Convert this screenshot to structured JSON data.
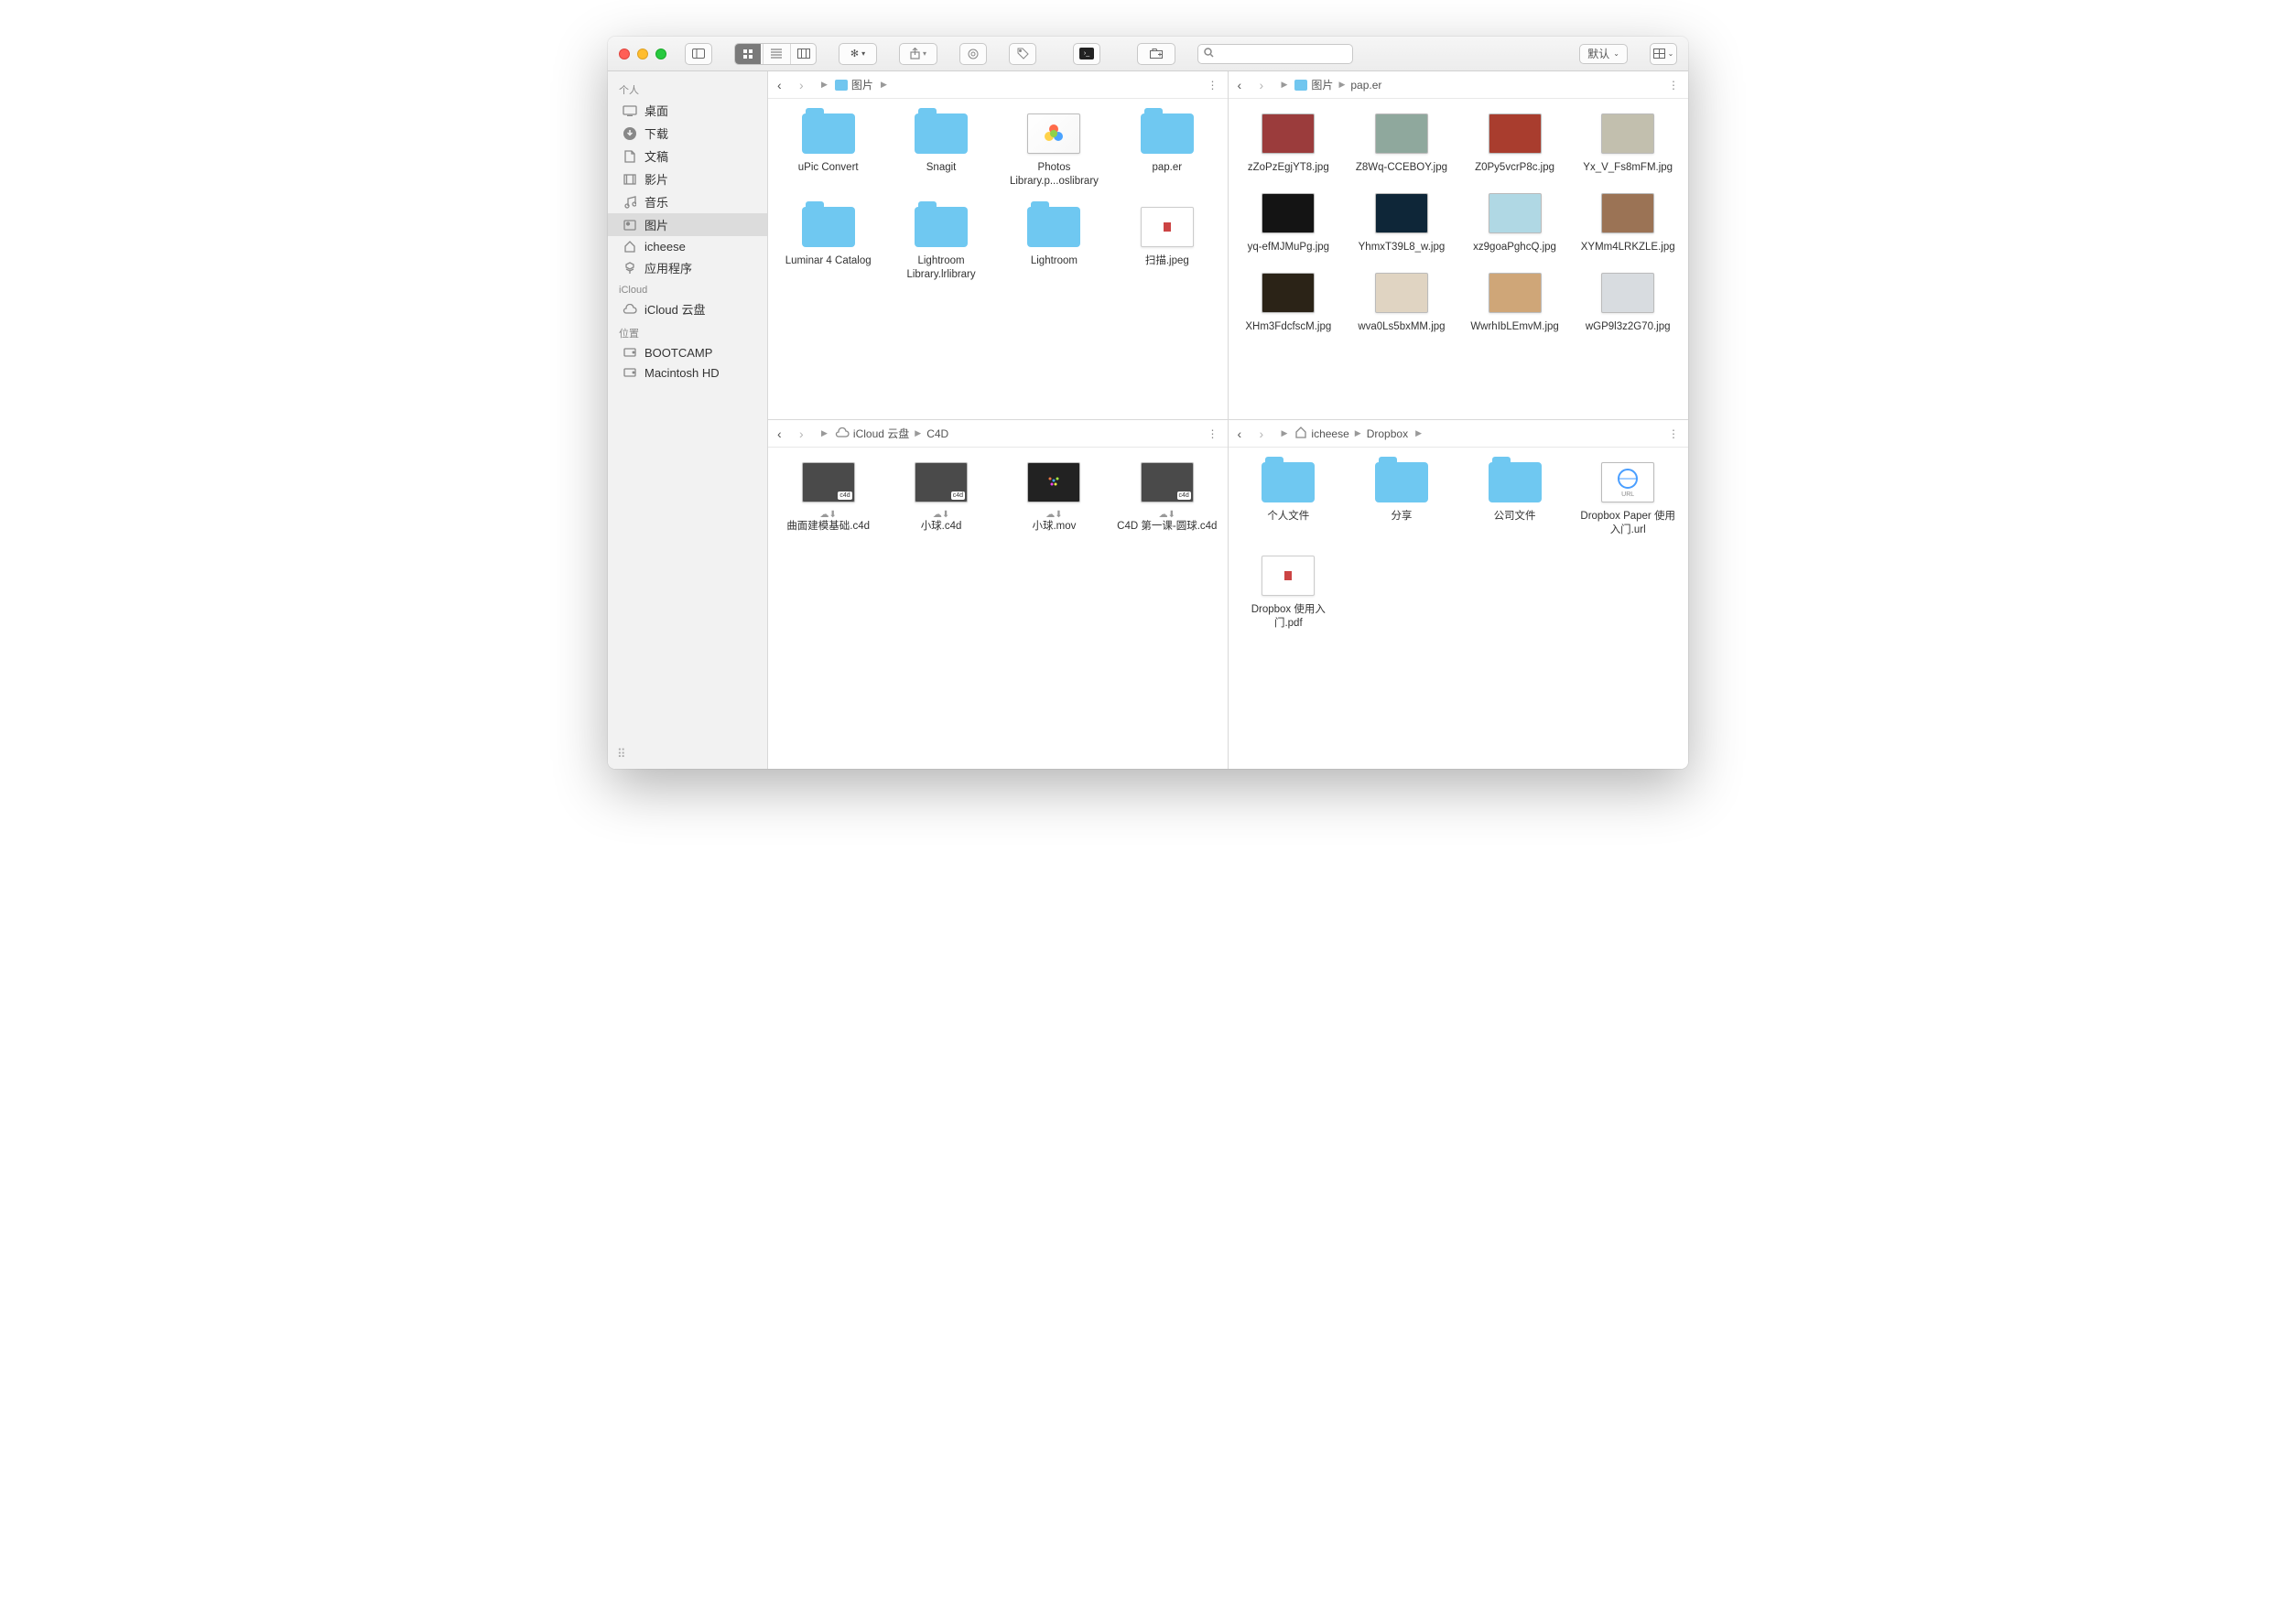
{
  "toolbar": {
    "default_label": "默认",
    "search_placeholder": ""
  },
  "sidebar": {
    "personal_header": "个人",
    "items_personal": [
      {
        "icon": "desktop",
        "label": "桌面"
      },
      {
        "icon": "download",
        "label": "下载"
      },
      {
        "icon": "documents",
        "label": "文稿"
      },
      {
        "icon": "movies",
        "label": "影片"
      },
      {
        "icon": "music",
        "label": "音乐"
      },
      {
        "icon": "pictures",
        "label": "图片"
      },
      {
        "icon": "home",
        "label": "icheese"
      },
      {
        "icon": "apps",
        "label": "应用程序"
      }
    ],
    "icloud_header": "iCloud",
    "items_icloud": [
      {
        "icon": "cloud",
        "label": "iCloud 云盘"
      }
    ],
    "locations_header": "位置",
    "items_locations": [
      {
        "icon": "disk",
        "label": "BOOTCAMP"
      },
      {
        "icon": "disk",
        "label": "Macintosh HD"
      }
    ]
  },
  "panes": [
    {
      "breadcrumb": [
        {
          "icon": "folder",
          "label": "图片"
        }
      ],
      "items": [
        {
          "type": "folder",
          "label": "uPic Convert"
        },
        {
          "type": "folder",
          "label": "Snagit"
        },
        {
          "type": "photos",
          "label": "Photos Library.p...oslibrary"
        },
        {
          "type": "folder",
          "label": "pap.er"
        },
        {
          "type": "folder",
          "label": "Luminar 4 Catalog"
        },
        {
          "type": "folder",
          "label": "Lightroom Library.lrlibrary"
        },
        {
          "type": "folder",
          "label": "Lightroom"
        },
        {
          "type": "doc",
          "label": "扫描.jpeg"
        }
      ]
    },
    {
      "breadcrumb": [
        {
          "icon": "folder",
          "label": "图片"
        },
        {
          "icon": "none",
          "label": "pap.er"
        }
      ],
      "items": [
        {
          "type": "thumb",
          "bg": "#9b3c3c",
          "label": "zZoPzEgjYT8.jpg"
        },
        {
          "type": "thumb",
          "bg": "#8fa89d",
          "label": "Z8Wq-CCEBOY.jpg"
        },
        {
          "type": "thumb",
          "bg": "#a93d2e",
          "label": "Z0Py5vcrP8c.jpg"
        },
        {
          "type": "thumb",
          "bg": "#c2bfae",
          "label": "Yx_V_Fs8mFM.jpg"
        },
        {
          "type": "thumb",
          "bg": "#141414",
          "label": "yq-efMJMuPg.jpg"
        },
        {
          "type": "thumb",
          "bg": "#0e2638",
          "label": "YhmxT39L8_w.jpg"
        },
        {
          "type": "thumb",
          "bg": "#b0d8e4",
          "label": "xz9goaPghcQ.jpg"
        },
        {
          "type": "thumb",
          "bg": "#9b7355",
          "label": "XYMm4LRKZLE.jpg"
        },
        {
          "type": "thumb",
          "bg": "#2b2317",
          "label": "XHm3FdcfscM.jpg"
        },
        {
          "type": "thumb",
          "bg": "#e0d4c2",
          "label": "wva0Ls5bxMM.jpg"
        },
        {
          "type": "thumb",
          "bg": "#cfa678",
          "label": "WwrhIbLEmvM.jpg"
        },
        {
          "type": "thumb",
          "bg": "#d8dce0",
          "label": "wGP9l3z2G70.jpg"
        }
      ]
    },
    {
      "breadcrumb": [
        {
          "icon": "cloud",
          "label": "iCloud 云盘"
        },
        {
          "icon": "none",
          "label": "C4D"
        }
      ],
      "items": [
        {
          "type": "c4d",
          "label": "曲面建模基础.c4d",
          "cloud": true
        },
        {
          "type": "c4d",
          "label": "小球.c4d",
          "cloud": true
        },
        {
          "type": "dark",
          "label": "小球.mov",
          "cloud": true
        },
        {
          "type": "c4d",
          "label": "C4D 第一课-圆球.c4d",
          "cloud": true
        }
      ]
    },
    {
      "breadcrumb": [
        {
          "icon": "home",
          "label": "icheese"
        },
        {
          "icon": "none",
          "label": "Dropbox"
        }
      ],
      "items": [
        {
          "type": "folder",
          "label": "个人文件"
        },
        {
          "type": "folder",
          "label": "分享"
        },
        {
          "type": "folder",
          "label": "公司文件"
        },
        {
          "type": "url",
          "label": "Dropbox Paper 使用入门.url"
        },
        {
          "type": "doc",
          "label": "Dropbox 使用入门.pdf"
        }
      ]
    }
  ]
}
